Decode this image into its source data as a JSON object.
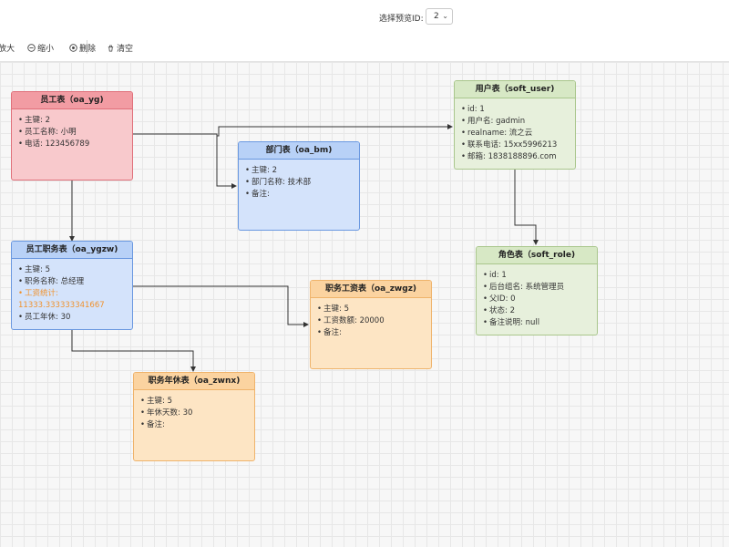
{
  "topbar": {
    "preview_label": "选择预览ID:",
    "preview_value": "2"
  },
  "toolbar": {
    "zoom_in": "放大",
    "zoom_out": "缩小",
    "delete": "删除",
    "clear": "清空"
  },
  "colors": {
    "red": "#f8c9cc",
    "blue": "#d4e3fb",
    "green": "#e7f0dc",
    "orange": "#fde5c4",
    "highlight_text": "#f0922e"
  },
  "nodes": {
    "oa_yg": {
      "title": "员工表（oa_yg)",
      "rows": [
        "主键: 2",
        "员工名称: 小明",
        "电话: 123456789"
      ]
    },
    "oa_bm": {
      "title": "部门表（oa_bm)",
      "rows": [
        "主键: 2",
        "部门名称: 技术部",
        "备注:"
      ]
    },
    "soft_user": {
      "title": "用户表（soft_user)",
      "rows": [
        "id: 1",
        "用户名: gadmin",
        "realname: 流之云",
        "联系电话: 15xx5996213",
        "邮箱: 1838188896.com"
      ]
    },
    "oa_ygzw": {
      "title": "员工职务表（oa_ygzw)",
      "rows": [
        "主键: 5",
        "职务名称: 总经理",
        "工资统计:",
        "11333.333333341667",
        "员工年休: 30"
      ]
    },
    "soft_role": {
      "title": "角色表（soft_role)",
      "rows": [
        "id: 1",
        "后台组名: 系统管理员",
        "父ID: 0",
        "状态: 2",
        "备注说明: null"
      ]
    },
    "oa_zwgz": {
      "title": "职务工资表（oa_zwgz)",
      "rows": [
        "主键: 5",
        "工资数额: 20000",
        "备注:"
      ]
    },
    "oa_zwnx": {
      "title": "职务年休表（oa_zwnx)",
      "rows": [
        "主键: 5",
        "年休天数: 30",
        "备注:"
      ]
    }
  }
}
